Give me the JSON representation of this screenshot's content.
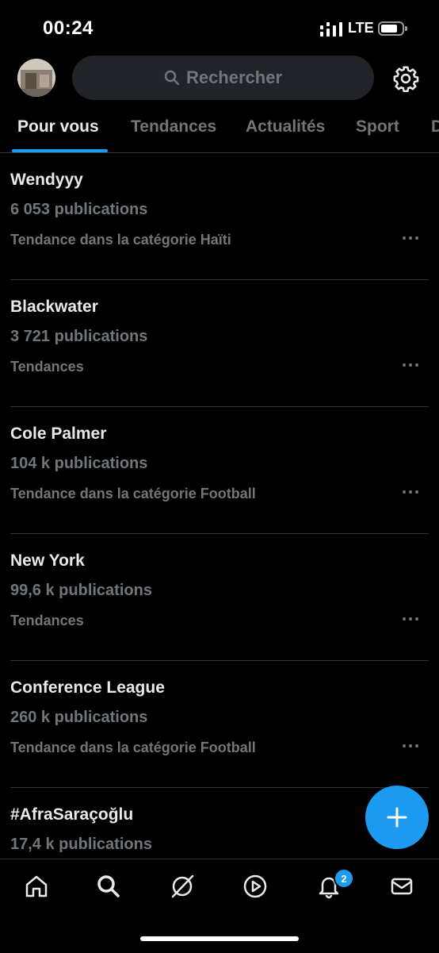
{
  "status_bar": {
    "time": "00:24",
    "network": "LTE"
  },
  "header": {
    "search_placeholder": "Rechercher"
  },
  "tabs": [
    {
      "label": "Pour vous",
      "active": true
    },
    {
      "label": "Tendances"
    },
    {
      "label": "Actualités"
    },
    {
      "label": "Sport"
    },
    {
      "label": "D"
    }
  ],
  "trends": [
    {
      "name": "Wendyyy",
      "count": "6 053 publications",
      "category": "Tendance dans la catégorie Haïti"
    },
    {
      "name": "Blackwater",
      "count": "3 721 publications",
      "category": "Tendances"
    },
    {
      "name": "Cole Palmer",
      "count": "104 k publications",
      "category": "Tendance dans la catégorie Football"
    },
    {
      "name": "New York",
      "count": "99,6 k publications",
      "category": "Tendances"
    },
    {
      "name": "Conference League",
      "count": "260 k publications",
      "category": "Tendance dans la catégorie Football"
    },
    {
      "name": "#AfraSaraçoğlu",
      "count": "17,4 k publications",
      "category": ""
    }
  ],
  "bottom_nav": {
    "items": [
      "home-icon",
      "search-icon",
      "grok-icon",
      "play-icon",
      "notifications-icon",
      "messages-icon"
    ],
    "notifications_badge": "2"
  },
  "colors": {
    "accent": "#1d9bf0",
    "background": "#000000",
    "muted": "#71767b"
  }
}
